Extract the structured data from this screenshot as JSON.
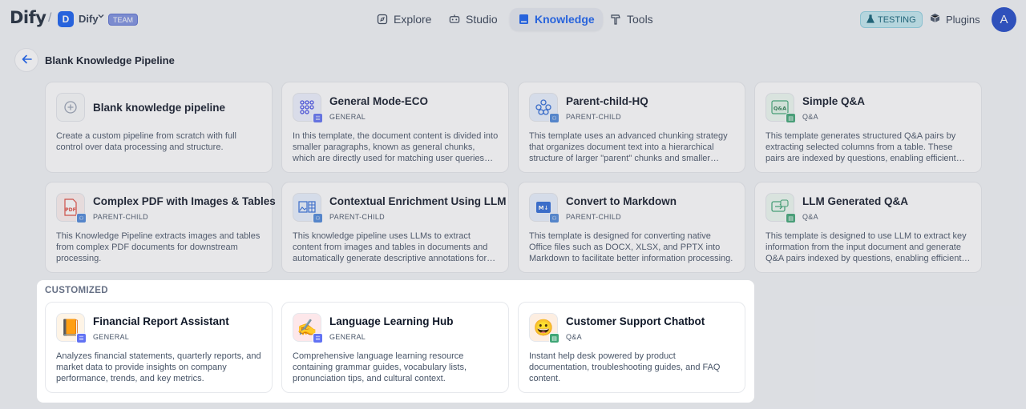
{
  "header": {
    "logo": "Dify",
    "workspace": {
      "initial": "D",
      "name": "Dify",
      "badge": "TEAM"
    },
    "nav": [
      {
        "label": "Explore",
        "icon": "compass-icon"
      },
      {
        "label": "Studio",
        "icon": "robot-icon"
      },
      {
        "label": "Knowledge",
        "icon": "book-icon",
        "active": true
      },
      {
        "label": "Tools",
        "icon": "hammer-icon"
      }
    ],
    "env_badge": "TESTING",
    "plugins": "Plugins",
    "user_initial": "A"
  },
  "page": {
    "title": "Blank Knowledge Pipeline"
  },
  "templates": [
    {
      "title": "Blank knowledge pipeline",
      "subtitle": "",
      "desc": "Create a custom pipeline from scratch with full control over data processing and structure.",
      "icon": "plus-circle-icon"
    },
    {
      "title": "General Mode-ECO",
      "subtitle": "GENERAL",
      "desc": "In this template, the document content is divided into smaller paragraphs, known as general chunks, which are directly used for matching user queries and retrieval.",
      "icon": "dots-grid-icon"
    },
    {
      "title": "Parent-child-HQ",
      "subtitle": "PARENT-CHILD",
      "desc": "This template uses an advanced chunking strategy that organizes document text into a hierarchical structure of larger \"parent\" chunks and smaller \"child\" chunks.",
      "icon": "hierarchy-icon"
    },
    {
      "title": "Simple Q&A",
      "subtitle": "Q&A",
      "desc": "This template generates structured Q&A pairs by extracting selected columns from a table. These pairs are indexed by questions, enabling efficient retrieval.",
      "icon": "qa-table-icon"
    },
    {
      "title": "Complex PDF with Images & Tables",
      "subtitle": "PARENT-CHILD",
      "desc": "This Knowledge Pipeline extracts images and tables from complex PDF documents for downstream processing.",
      "icon": "pdf-icon"
    },
    {
      "title": "Contextual Enrichment Using LLM",
      "subtitle": "PARENT-CHILD",
      "desc": "This knowledge pipeline uses LLMs to extract content from images and tables in documents and automatically generate descriptive annotations for them.",
      "icon": "image-table-icon"
    },
    {
      "title": "Convert to Markdown",
      "subtitle": "PARENT-CHILD",
      "desc": "This template is designed for converting native Office files such as DOCX, XLSX, and PPTX into Markdown to facilitate better information processing.",
      "icon": "markdown-icon"
    },
    {
      "title": "LLM Generated Q&A",
      "subtitle": "Q&A",
      "desc": "This template is designed to use LLM to extract key information from the input document and generate Q&A pairs indexed by questions, enabling efficient retrieval.",
      "icon": "qa-chat-icon"
    }
  ],
  "customized": {
    "label": "CUSTOMIZED",
    "items": [
      {
        "title": "Financial Report Assistant",
        "subtitle": "GENERAL",
        "desc": "Analyzes financial statements, quarterly reports, and market data to provide insights on company performance, trends, and key metrics.",
        "emoji": "📙"
      },
      {
        "title": "Language Learning Hub",
        "subtitle": "GENERAL",
        "desc": "Comprehensive language learning resource containing grammar guides, vocabulary lists, pronunciation tips, and cultural context.",
        "emoji": "✍️"
      },
      {
        "title": "Customer Support Chatbot",
        "subtitle": "Q&A",
        "desc": "Instant help desk powered by product documentation, troubleshooting guides, and FAQ content.",
        "emoji": "😀"
      }
    ]
  },
  "colors": {
    "accent": "#155eef",
    "general_badge": "#6172f3",
    "parent_child_badge": "#4e88d9",
    "qa_badge": "#3fa676"
  }
}
